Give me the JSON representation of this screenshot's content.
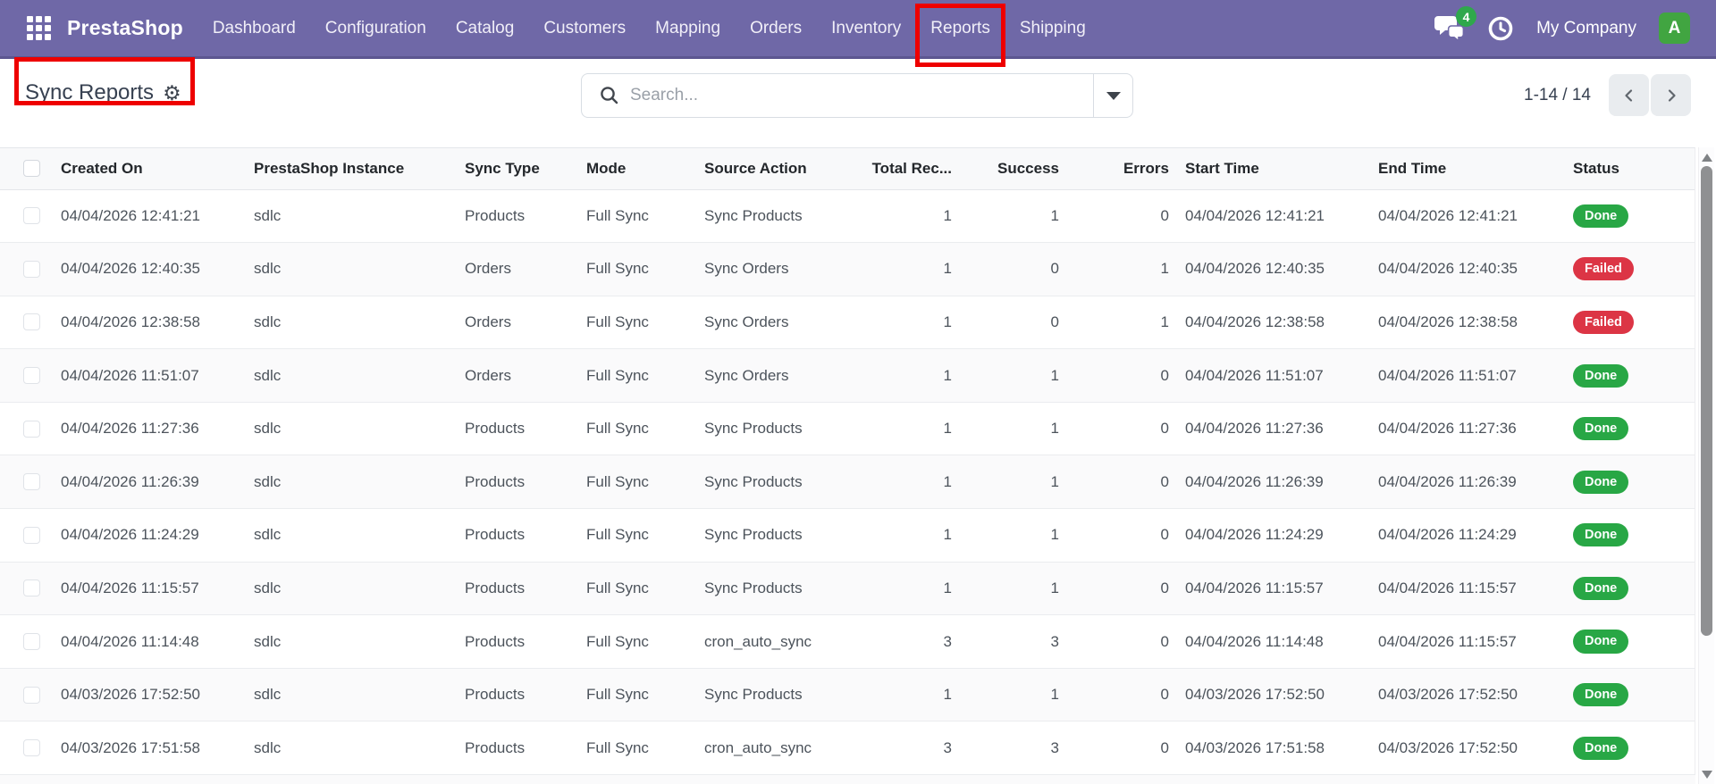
{
  "topbar": {
    "brand": "PrestaShop",
    "nav_items": [
      "Dashboard",
      "Configuration",
      "Catalog",
      "Customers",
      "Mapping",
      "Orders",
      "Inventory",
      "Reports",
      "Shipping"
    ],
    "highlighted_nav": "Reports",
    "chat_badge": "4",
    "company_name": "My Company",
    "avatar_initial": "A"
  },
  "toolbar": {
    "page_title": "Sync Reports",
    "search_placeholder": "Search...",
    "pager_text": "1-14 / 14"
  },
  "icons": {
    "apps_grid": "3x3-grid",
    "chat": "speech-bubbles",
    "activities": "clock",
    "search": "magnifier",
    "filter_caret": "caret-down",
    "gear": "⚙",
    "pager_prev": "chevron-left",
    "pager_next": "chevron-right",
    "scroll_up": "triangle-up",
    "scroll_down": "triangle-down"
  },
  "colors": {
    "topbar_bg": "#6f68a7",
    "topbar_border": "#5c5690",
    "annotation_red": "#ee0000",
    "badge_green": "#2fa84c",
    "avatar_green": "#41a541"
  },
  "table": {
    "columns": [
      "Created On",
      "PrestaShop Instance",
      "Sync Type",
      "Mode",
      "Source Action",
      "Total Rec...",
      "Success",
      "Errors",
      "Start Time",
      "End Time",
      "Status"
    ],
    "status_colors": {
      "Done": "#28a745",
      "Failed": "#dc3545"
    },
    "rows": [
      {
        "created_on": "04/04/2026 12:41:21",
        "instance": "sdlc",
        "sync_type": "Products",
        "mode": "Full Sync",
        "source_action": "Sync Products",
        "total": "1",
        "success": "1",
        "errors": "0",
        "start_time": "04/04/2026 12:41:21",
        "end_time": "04/04/2026 12:41:21",
        "status": "Done"
      },
      {
        "created_on": "04/04/2026 12:40:35",
        "instance": "sdlc",
        "sync_type": "Orders",
        "mode": "Full Sync",
        "source_action": "Sync Orders",
        "total": "1",
        "success": "0",
        "errors": "1",
        "start_time": "04/04/2026 12:40:35",
        "end_time": "04/04/2026 12:40:35",
        "status": "Failed"
      },
      {
        "created_on": "04/04/2026 12:38:58",
        "instance": "sdlc",
        "sync_type": "Orders",
        "mode": "Full Sync",
        "source_action": "Sync Orders",
        "total": "1",
        "success": "0",
        "errors": "1",
        "start_time": "04/04/2026 12:38:58",
        "end_time": "04/04/2026 12:38:58",
        "status": "Failed"
      },
      {
        "created_on": "04/04/2026 11:51:07",
        "instance": "sdlc",
        "sync_type": "Orders",
        "mode": "Full Sync",
        "source_action": "Sync Orders",
        "total": "1",
        "success": "1",
        "errors": "0",
        "start_time": "04/04/2026 11:51:07",
        "end_time": "04/04/2026 11:51:07",
        "status": "Done"
      },
      {
        "created_on": "04/04/2026 11:27:36",
        "instance": "sdlc",
        "sync_type": "Products",
        "mode": "Full Sync",
        "source_action": "Sync Products",
        "total": "1",
        "success": "1",
        "errors": "0",
        "start_time": "04/04/2026 11:27:36",
        "end_time": "04/04/2026 11:27:36",
        "status": "Done"
      },
      {
        "created_on": "04/04/2026 11:26:39",
        "instance": "sdlc",
        "sync_type": "Products",
        "mode": "Full Sync",
        "source_action": "Sync Products",
        "total": "1",
        "success": "1",
        "errors": "0",
        "start_time": "04/04/2026 11:26:39",
        "end_time": "04/04/2026 11:26:39",
        "status": "Done"
      },
      {
        "created_on": "04/04/2026 11:24:29",
        "instance": "sdlc",
        "sync_type": "Products",
        "mode": "Full Sync",
        "source_action": "Sync Products",
        "total": "1",
        "success": "1",
        "errors": "0",
        "start_time": "04/04/2026 11:24:29",
        "end_time": "04/04/2026 11:24:29",
        "status": "Done"
      },
      {
        "created_on": "04/04/2026 11:15:57",
        "instance": "sdlc",
        "sync_type": "Products",
        "mode": "Full Sync",
        "source_action": "Sync Products",
        "total": "1",
        "success": "1",
        "errors": "0",
        "start_time": "04/04/2026 11:15:57",
        "end_time": "04/04/2026 11:15:57",
        "status": "Done"
      },
      {
        "created_on": "04/04/2026 11:14:48",
        "instance": "sdlc",
        "sync_type": "Products",
        "mode": "Full Sync",
        "source_action": "cron_auto_sync",
        "total": "3",
        "success": "3",
        "errors": "0",
        "start_time": "04/04/2026 11:14:48",
        "end_time": "04/04/2026 11:15:57",
        "status": "Done"
      },
      {
        "created_on": "04/03/2026 17:52:50",
        "instance": "sdlc",
        "sync_type": "Products",
        "mode": "Full Sync",
        "source_action": "Sync Products",
        "total": "1",
        "success": "1",
        "errors": "0",
        "start_time": "04/03/2026 17:52:50",
        "end_time": "04/03/2026 17:52:50",
        "status": "Done"
      },
      {
        "created_on": "04/03/2026 17:51:58",
        "instance": "sdlc",
        "sync_type": "Products",
        "mode": "Full Sync",
        "source_action": "cron_auto_sync",
        "total": "3",
        "success": "3",
        "errors": "0",
        "start_time": "04/03/2026 17:51:58",
        "end_time": "04/03/2026 17:52:50",
        "status": "Done"
      }
    ]
  }
}
